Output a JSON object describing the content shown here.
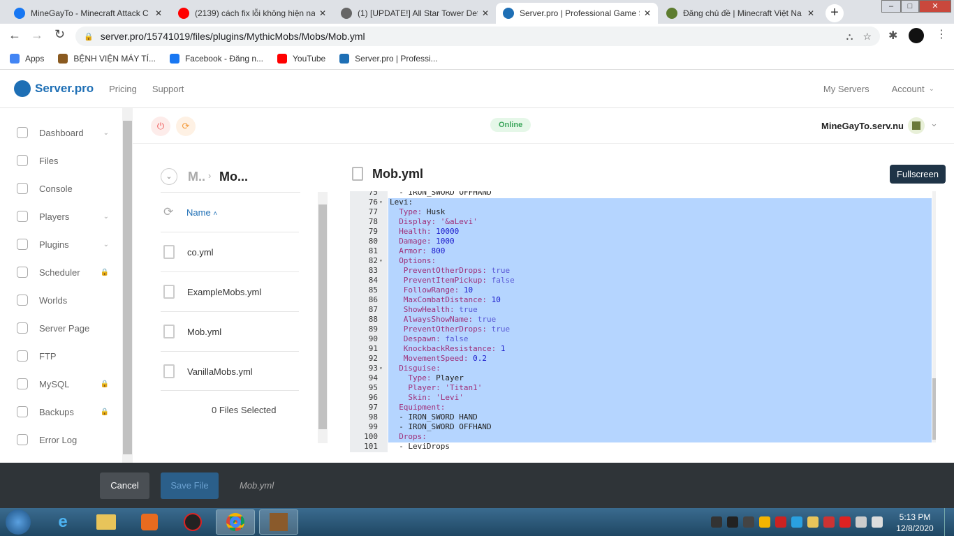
{
  "browser": {
    "tabs": [
      {
        "title": "MineGayTo - Minecraft Attack C",
        "icon": "facebook-icon",
        "color": "#1877f2"
      },
      {
        "title": "(2139) cách fix lỗi không hiện na",
        "icon": "youtube-icon",
        "color": "#ff0000"
      },
      {
        "title": "(1) [UPDATE!] All Star Tower Def",
        "icon": "roblox-icon",
        "color": "#666666"
      },
      {
        "title": "Server.pro | Professional Game S",
        "icon": "serverpro-icon",
        "color": "#1e6fb5",
        "active": true
      },
      {
        "title": "Đăng chủ đề | Minecraft Việt Na",
        "icon": "minecraft-icon",
        "color": "#5d7c2f"
      }
    ],
    "url": "server.pro/15741019/files/plugins/MythicMobs/Mobs/Mob.yml",
    "bookmarks": [
      {
        "label": "Apps",
        "icon": "apps-icon",
        "color": "#4285f4"
      },
      {
        "label": "BỆNH VIỆN MÁY TÍ...",
        "icon": "site-icon",
        "color": "#8a5a20"
      },
      {
        "label": "Facebook - Đăng n...",
        "icon": "facebook-icon",
        "color": "#1877f2"
      },
      {
        "label": "YouTube",
        "icon": "youtube-icon",
        "color": "#ff0000"
      },
      {
        "label": "Server.pro | Professi...",
        "icon": "serverpro-icon",
        "color": "#1e6fb5"
      }
    ]
  },
  "site": {
    "logo": "Server.pro",
    "nav": [
      "Pricing",
      "Support"
    ],
    "right_nav": [
      "My Servers",
      "Account"
    ],
    "status": "Online",
    "server_name": "MineGayTo.serv.nu",
    "sidebar": [
      {
        "label": "Dashboard",
        "chevron": true
      },
      {
        "label": "Files"
      },
      {
        "label": "Console"
      },
      {
        "label": "Players",
        "chevron": true
      },
      {
        "label": "Plugins",
        "chevron": true
      },
      {
        "label": "Scheduler",
        "lock": true
      },
      {
        "label": "Worlds"
      },
      {
        "label": "Server Page"
      },
      {
        "label": "FTP"
      },
      {
        "label": "MySQL",
        "lock": true
      },
      {
        "label": "Backups",
        "lock": true
      },
      {
        "label": "Error Log"
      }
    ],
    "files": {
      "breadcrumb": [
        "M..",
        "Mo..."
      ],
      "sort_label": "Name",
      "items": [
        "co.yml",
        "ExampleMobs.yml",
        "Mob.yml",
        "VanillaMobs.yml"
      ],
      "selected_text": "0 Files Selected"
    },
    "editor": {
      "title": "Mob.yml",
      "fullscreen": "Fullscreen",
      "partial_line": {
        "n": "75",
        "text": "  - IRON_SWORD OFFHAND"
      },
      "lines": [
        {
          "n": "76",
          "fold": true,
          "indent": 0,
          "key": "Levi:",
          "value": "",
          "vt": "plain"
        },
        {
          "n": "77",
          "indent": 2,
          "key": "Type:",
          "value": " Husk",
          "vt": "plain"
        },
        {
          "n": "78",
          "indent": 2,
          "key": "Display:",
          "value": " '&aLevi'",
          "vt": "str"
        },
        {
          "n": "79",
          "indent": 2,
          "key": "Health:",
          "value": " 10000",
          "vt": "num"
        },
        {
          "n": "80",
          "indent": 2,
          "key": "Damage:",
          "value": " 1000",
          "vt": "num"
        },
        {
          "n": "81",
          "indent": 2,
          "key": "Armor:",
          "value": " 800",
          "vt": "num"
        },
        {
          "n": "82",
          "fold": true,
          "indent": 2,
          "key": "Options:",
          "value": "",
          "vt": "plain"
        },
        {
          "n": "83",
          "indent": 3,
          "key": "PreventOtherDrops:",
          "value": " true",
          "vt": "bool"
        },
        {
          "n": "84",
          "indent": 3,
          "key": "PreventItemPickup:",
          "value": " false",
          "vt": "bool"
        },
        {
          "n": "85",
          "indent": 3,
          "key": "FollowRange:",
          "value": " 10",
          "vt": "num"
        },
        {
          "n": "86",
          "indent": 3,
          "key": "MaxCombatDistance:",
          "value": " 10",
          "vt": "num"
        },
        {
          "n": "87",
          "indent": 3,
          "key": "ShowHealth:",
          "value": " true",
          "vt": "bool"
        },
        {
          "n": "88",
          "indent": 3,
          "key": "AlwaysShowName:",
          "value": " true",
          "vt": "bool"
        },
        {
          "n": "89",
          "indent": 3,
          "key": "PreventOtherDrops:",
          "value": " true",
          "vt": "bool"
        },
        {
          "n": "90",
          "indent": 3,
          "key": "Despawn:",
          "value": " false",
          "vt": "bool"
        },
        {
          "n": "91",
          "indent": 3,
          "key": "KnockbackResistance:",
          "value": " 1",
          "vt": "num"
        },
        {
          "n": "92",
          "indent": 3,
          "key": "MovementSpeed:",
          "value": " 0.2",
          "vt": "num"
        },
        {
          "n": "93",
          "fold": true,
          "indent": 2,
          "key": "Disguise:",
          "value": "",
          "vt": "plain"
        },
        {
          "n": "94",
          "indent": 4,
          "key": "Type:",
          "value": " Player",
          "vt": "plain"
        },
        {
          "n": "95",
          "indent": 4,
          "key": "Player:",
          "value": " 'Titan1'",
          "vt": "str"
        },
        {
          "n": "96",
          "indent": 4,
          "key": "Skin:",
          "value": " 'Levi'",
          "vt": "str"
        },
        {
          "n": "97",
          "indent": 2,
          "key": "Equipment:",
          "value": "",
          "vt": "plain"
        },
        {
          "n": "98",
          "indent": 2,
          "key": "",
          "value": "- IRON_SWORD HAND",
          "vt": "plain"
        },
        {
          "n": "99",
          "indent": 2,
          "key": "",
          "value": "- IRON_SWORD OFFHAND",
          "vt": "plain"
        },
        {
          "n": "100",
          "indent": 2,
          "key": "Drops:",
          "value": "",
          "vt": "plain"
        },
        {
          "n": "101",
          "indent": 2,
          "key": "",
          "value": "- LeviDrops",
          "vt": "plain"
        }
      ]
    },
    "footer": {
      "cancel": "Cancel",
      "save": "Save File",
      "filename": "Mob.yml"
    }
  },
  "taskbar": {
    "time": "5:13 PM",
    "date": "12/8/2020"
  },
  "colors": {
    "brand": "#1e6fb5",
    "selection": "#b5d5ff",
    "footer": "#2f3438",
    "save": "#2b5f8a"
  }
}
